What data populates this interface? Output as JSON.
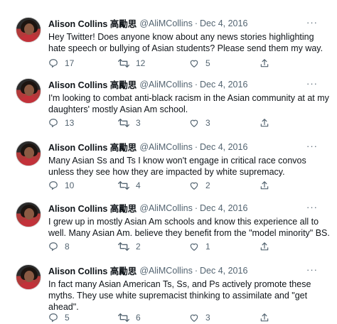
{
  "tweets": [
    {
      "name": "Alison Collins 高勵思",
      "handle": "@AliMCollins",
      "date": "Dec 4, 2016",
      "text": "Hey Twitter! Does anyone know about any news stories highlighting hate speech or bullying of Asian students? Please send them my way.",
      "replies": "17",
      "retweets": "12",
      "likes": "5"
    },
    {
      "name": "Alison Collins 高勵思",
      "handle": "@AliMCollins",
      "date": "Dec 4, 2016",
      "text": "I'm looking to combat anti-black racism in the Asian community at at my daughters' mostly Asian Am school.",
      "replies": "13",
      "retweets": "3",
      "likes": "3"
    },
    {
      "name": "Alison Collins 高勵思",
      "handle": "@AliMCollins",
      "date": "Dec 4, 2016",
      "text": "Many Asian Ss and Ts I know won't engage in critical race convos unless they see how they are impacted by white supremacy.",
      "replies": "10",
      "retweets": "4",
      "likes": "2"
    },
    {
      "name": "Alison Collins 高勵思",
      "handle": "@AliMCollins",
      "date": "Dec 4, 2016",
      "text": "I grew up in mostly Asian Am schools and know this experience all to well. Many Asian Am. believe they benefit from the \"model minority\" BS.",
      "replies": "8",
      "retweets": "2",
      "likes": "1"
    },
    {
      "name": "Alison Collins 高勵思",
      "handle": "@AliMCollins",
      "date": "Dec 4, 2016",
      "text": "In fact many Asian American Ts, Ss, and Ps actively promote these myths. They use white supremacist thinking to assimilate and \"get ahead\".",
      "replies": "5",
      "retweets": "6",
      "likes": "3"
    }
  ],
  "ui": {
    "separator": "·",
    "more_glyph": "···"
  },
  "icons": {
    "avatar": "user-avatar-photo",
    "reply": "reply-icon",
    "retweet": "retweet-icon",
    "like": "heart-icon",
    "share": "share-icon"
  },
  "colors": {
    "text": "#0f1419",
    "secondary": "#536471"
  }
}
